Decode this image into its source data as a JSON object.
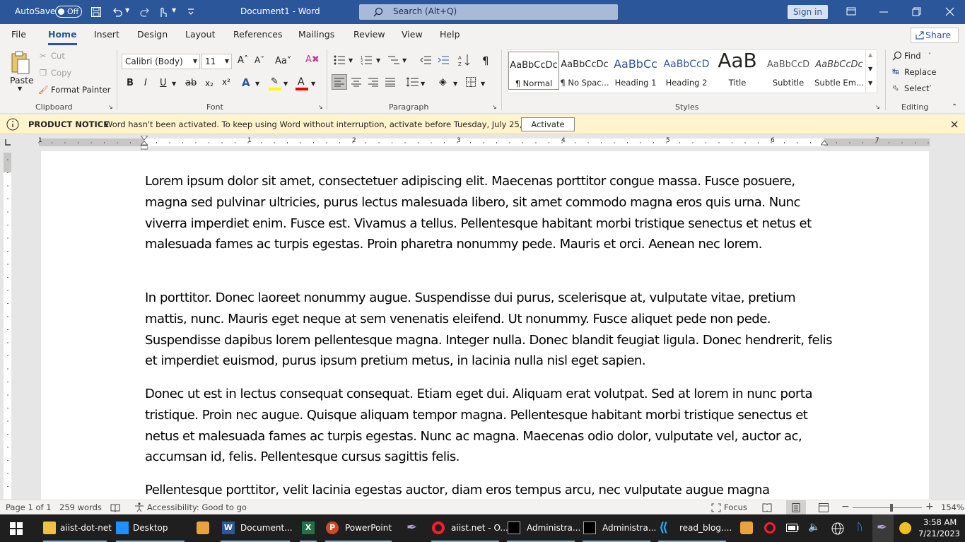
{
  "titlebar": {
    "autosave_label": "AutoSave",
    "autosave_state": "Off",
    "doc_title": "Document1  -  Word",
    "search_placeholder": "Search (Alt+Q)",
    "signin_label": "Sign in"
  },
  "tabs": [
    "File",
    "Home",
    "Insert",
    "Design",
    "Layout",
    "References",
    "Mailings",
    "Review",
    "View",
    "Help"
  ],
  "share_label": "Share",
  "clipboard": {
    "paste": "Paste",
    "cut": "Cut",
    "copy": "Copy",
    "format_painter": "Format Painter",
    "group": "Clipboard"
  },
  "font": {
    "family": "Calibri (Body)",
    "size": "11",
    "group": "Font"
  },
  "paragraph": {
    "group": "Paragraph"
  },
  "styles": {
    "group": "Styles",
    "items": [
      {
        "preview": "AaBbCcDc",
        "name": "¶ Normal"
      },
      {
        "preview": "AaBbCcDc",
        "name": "¶ No Spac..."
      },
      {
        "preview": "AaBbCc",
        "name": "Heading 1"
      },
      {
        "preview": "AaBbCcD",
        "name": "Heading 2"
      },
      {
        "preview": "AaB",
        "name": "Title"
      },
      {
        "preview": "AaBbCcD",
        "name": "Subtitle"
      },
      {
        "preview": "AaBbCcDc",
        "name": "Subtle Em..."
      }
    ]
  },
  "editing": {
    "find": "Find",
    "replace": "Replace",
    "select": "Select",
    "group": "Editing"
  },
  "notice": {
    "title": "PRODUCT NOTICE",
    "message": "Word hasn't been activated. To keep using Word without interruption, activate before Tuesday, July 25, 2023.",
    "button": "Activate"
  },
  "ruler_numbers": [
    "1",
    "1",
    "2",
    "3",
    "4",
    "5",
    "6",
    "7"
  ],
  "document": {
    "paragraphs": [
      "Lorem ipsum dolor sit amet, consectetuer adipiscing elit. Maecenas porttitor congue massa. Fusce posuere, magna sed pulvinar ultricies, purus lectus malesuada libero, sit amet commodo magna eros quis urna. Nunc viverra imperdiet enim. Fusce est. Vivamus a tellus. Pellentesque habitant morbi tristique senectus et netus et malesuada fames ac turpis egestas. Proin pharetra nonummy pede. Mauris et orci. Aenean nec lorem.",
      "In porttitor. Donec laoreet nonummy augue. Suspendisse dui purus, scelerisque at, vulputate vitae, pretium mattis, nunc. Mauris eget neque at sem venenatis eleifend. Ut nonummy. Fusce aliquet pede non pede. Suspendisse dapibus lorem pellentesque magna. Integer nulla. Donec blandit feugiat ligula. Donec hendrerit, felis et imperdiet euismod, purus ipsum pretium metus, in lacinia nulla nisl eget sapien.",
      "Donec ut est in lectus consequat consequat. Etiam eget dui. Aliquam erat volutpat. Sed at lorem in nunc porta tristique. Proin nec augue. Quisque aliquam tempor magna. Pellentesque habitant morbi tristique senectus et netus et malesuada fames ac turpis egestas. Nunc ac magna. Maecenas odio dolor, vulputate vel, auctor ac, accumsan id, felis. Pellentesque cursus sagittis felis.",
      "Pellentesque porttitor, velit lacinia egestas auctor, diam eros tempus arcu, nec vulputate augue magna"
    ]
  },
  "status": {
    "page": "Page 1 of 1",
    "words": "259 words",
    "accessibility": "Accessibility: Good to go",
    "focus": "Focus",
    "zoom": "154%"
  },
  "taskbar": {
    "items": [
      "aiist-dot-net",
      "Desktop",
      "Document...",
      "PowerPoint",
      "aiist.net - O...",
      "Administra...",
      "Administra...",
      "read_blog...."
    ],
    "time": "3:58 AM",
    "date": "7/21/2023"
  },
  "colors": {
    "word_blue": "#2b579a",
    "notice_bg": "#fff4ce",
    "taskbar_bg": "#1f1f1f"
  }
}
